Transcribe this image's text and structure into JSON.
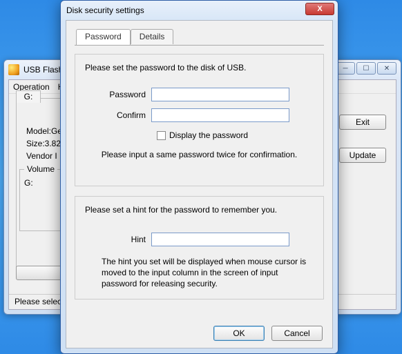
{
  "background_window": {
    "title": "USB Flash S",
    "menu": {
      "operation": "Operation",
      "help": "H"
    },
    "drive_tab": "G:",
    "info": {
      "model": "Model:Ge",
      "size": "Size:3.82",
      "vendor": "Vendor I"
    },
    "volume_label": "Volume",
    "volume_drive": "G:",
    "exit_label": "Exit",
    "update_label": "Update",
    "status_text": "Please select a"
  },
  "dialog": {
    "title": "Disk security settings",
    "tabs": {
      "password": "Password",
      "details": "Details"
    },
    "group1": {
      "intro": "Please set the password to the disk of USB.",
      "password_label": "Password",
      "confirm_label": "Confirm",
      "display_checkbox": "Display the password",
      "note": "Please input a same password twice for confirmation."
    },
    "group2": {
      "intro": "Please set a hint for the password to remember you.",
      "hint_label": "Hint",
      "note": "The hint you set will be displayed when mouse cursor is moved to the input column in the screen of input password for releasing security."
    },
    "buttons": {
      "ok": "OK",
      "cancel": "Cancel"
    }
  }
}
